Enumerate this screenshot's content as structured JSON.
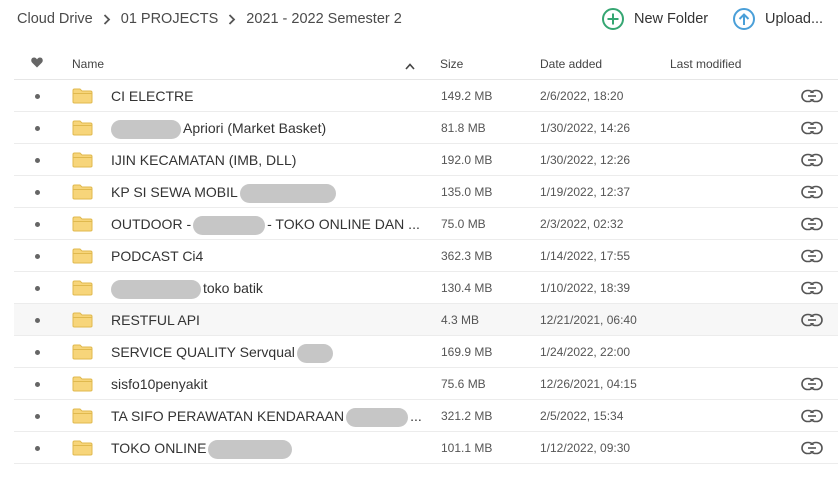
{
  "breadcrumb": [
    "Cloud Drive",
    "01 PROJECTS",
    "2021 - 2022 Semester 2"
  ],
  "actions": {
    "new_folder": "New Folder",
    "upload": "Upload..."
  },
  "columns": {
    "name": "Name",
    "size": "Size",
    "date_added": "Date added",
    "last_modified": "Last modified"
  },
  "colors": {
    "folder": "#f7d57a",
    "accent_green": "#35a672",
    "accent_blue": "#4a9fd8"
  },
  "rows": [
    {
      "name_parts": [
        "CI ELECTRE"
      ],
      "size": "149.2 MB",
      "date": "2/6/2022, 18:20",
      "share": true
    },
    {
      "name_parts": [
        "",
        "Apriori (Market Basket)"
      ],
      "size": "81.8 MB",
      "date": "1/30/2022, 14:26",
      "share": true
    },
    {
      "name_parts": [
        "IJIN KECAMATAN (IMB, DLL)"
      ],
      "size": "192.0 MB",
      "date": "1/30/2022, 12:26",
      "share": true
    },
    {
      "name_parts": [
        "KP SI SEWA MOBIL",
        ""
      ],
      "size": "135.0 MB",
      "date": "1/19/2022, 12:37",
      "share": true
    },
    {
      "name_parts": [
        "OUTDOOR -",
        "",
        "- TOKO ONLINE DAN ..."
      ],
      "size": "75.0 MB",
      "date": "2/3/2022, 02:32",
      "share": true
    },
    {
      "name_parts": [
        "PODCAST Ci4"
      ],
      "size": "362.3 MB",
      "date": "1/14/2022, 17:55",
      "share": true
    },
    {
      "name_parts": [
        "",
        "toko batik"
      ],
      "size": "130.4 MB",
      "date": "1/10/2022, 18:39",
      "share": true
    },
    {
      "name_parts": [
        "RESTFUL API"
      ],
      "size": "4.3 MB",
      "date": "12/21/2021, 06:40",
      "share": true
    },
    {
      "name_parts": [
        "SERVICE QUALITY Servqual",
        ""
      ],
      "size": "169.9 MB",
      "date": "1/24/2022, 22:00",
      "share": false
    },
    {
      "name_parts": [
        "sisfo10penyakit"
      ],
      "size": "75.6 MB",
      "date": "12/26/2021, 04:15",
      "share": true
    },
    {
      "name_parts": [
        "TA SIFO PERAWATAN KENDARAAN",
        "",
        "..."
      ],
      "size": "321.2 MB",
      "date": "2/5/2022, 15:34",
      "share": true
    },
    {
      "name_parts": [
        "TOKO ONLINE",
        ""
      ],
      "size": "101.1 MB",
      "date": "1/12/2022, 09:30",
      "share": true
    }
  ]
}
